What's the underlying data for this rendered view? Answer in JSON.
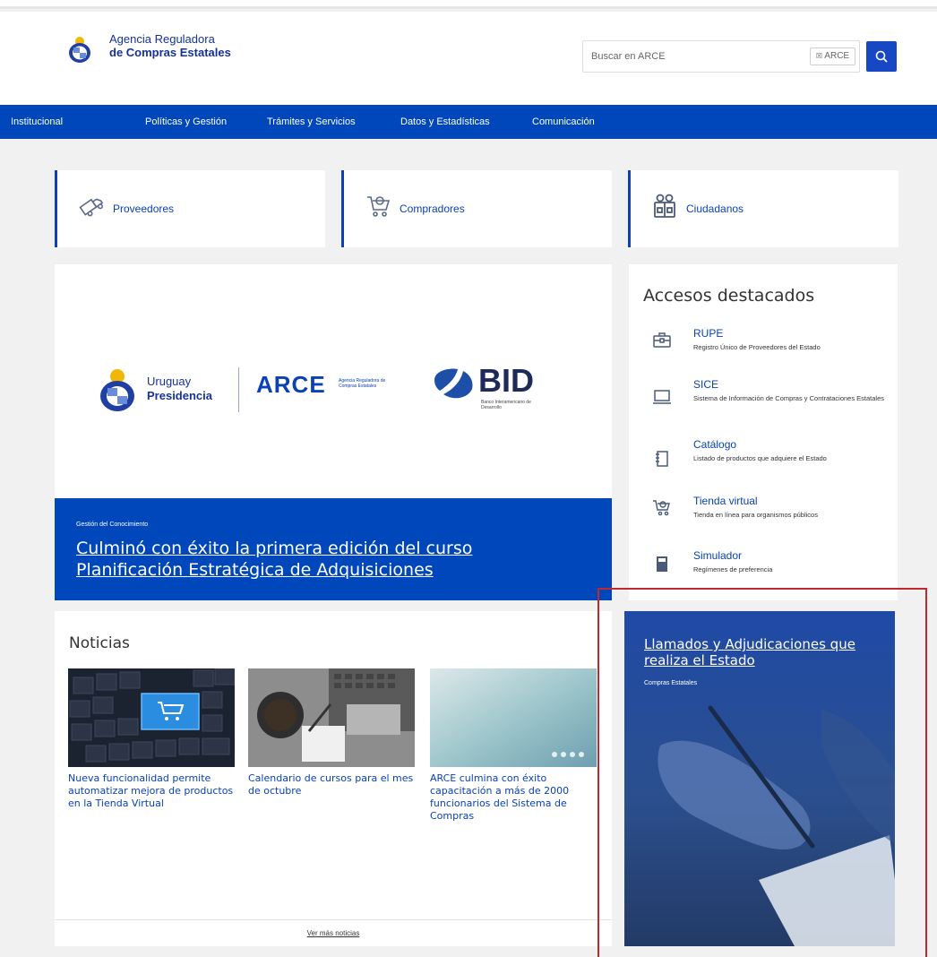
{
  "header": {
    "logo_line1": "Agencia Reguladora",
    "logo_line2": "de Compras Estatales",
    "search": {
      "placeholder": "Buscar en ARCE",
      "scope": "ARCE"
    }
  },
  "nav": {
    "items": [
      "Institucional",
      "Políticas y Gestión",
      "Trámites y Servicios",
      "Datos y Estadísticas",
      "Comunicación"
    ]
  },
  "audiences": [
    {
      "label": "Proveedores",
      "icon": "truck-icon"
    },
    {
      "label": "Compradores",
      "icon": "cart-icon"
    },
    {
      "label": "Ciudadanos",
      "icon": "people-icon"
    }
  ],
  "hero": {
    "partner_logos": {
      "uruguay": "Uruguay",
      "presidencia": "Presidencia",
      "arce": "ARCE",
      "arce_sub": "Agencia Reguladora de Compras Estatales",
      "bid": "BID",
      "bid_sub": "Banco Interamericano de Desarrollo"
    },
    "kicker": "Gestión del Conocimiento",
    "title": "Culminó con éxito la primera edición del curso Planificación Estratégica de Adquisiciones"
  },
  "accesos": {
    "title": "Accesos destacados",
    "items": [
      {
        "name": "RUPE",
        "desc": "Registro Único de Proveedores del Estado",
        "icon": "briefcase-icon"
      },
      {
        "name": "SICE",
        "desc": "Sistema de Información de Compras y Contrataciones Estatales",
        "icon": "monitor-icon"
      },
      {
        "name": "Catálogo",
        "desc": "Listado de productos que adquiere el Estado",
        "icon": "catalog-icon"
      },
      {
        "name": "Tienda virtual",
        "desc": "Tienda en línea para organismos públicos",
        "icon": "cart-icon"
      },
      {
        "name": "Simulador",
        "desc": "Regímenes de preferencia",
        "icon": "calculator-icon"
      }
    ]
  },
  "news": {
    "title": "Noticias",
    "items": [
      {
        "text": "Nueva funcionalidad permite automatizar mejora de productos en la Tienda Virtual",
        "image": "keyboard-cart-image"
      },
      {
        "text": "Calendario de cursos para el mes de octubre",
        "image": "coffee-laptop-image"
      },
      {
        "text": "ARCE culmina con éxito capacitación a más de 2000 funcionarios del Sistema de Compras",
        "image": "blurred-screen-image"
      }
    ],
    "more": "Ver más noticias"
  },
  "llamados": {
    "title": "Llamados y Adjudicaciones que realiza el Estado",
    "subtitle": "Compras Estatales"
  },
  "colors": {
    "primary": "#0047bb",
    "highlight": "#c0282d"
  }
}
